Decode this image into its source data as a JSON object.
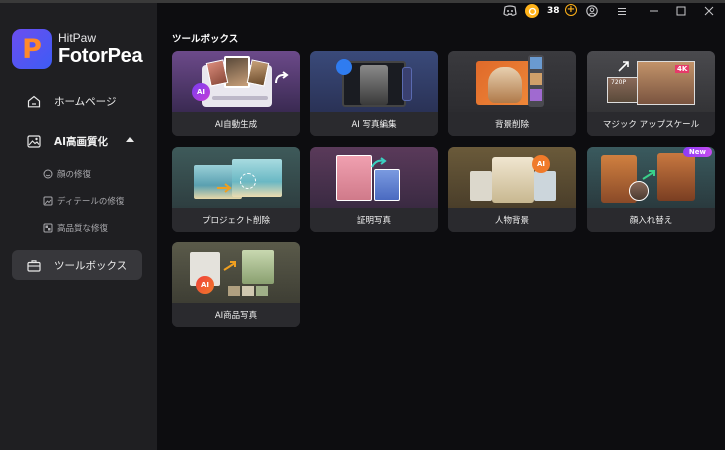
{
  "app": {
    "brand_small": "HitPaw",
    "brand_big": "FotorPea"
  },
  "titlebar": {
    "credits": "38",
    "plus": "+"
  },
  "sidebar": {
    "items": [
      {
        "label": "ホームページ"
      },
      {
        "label": "AI高画質化"
      },
      {
        "label": "ツールボックス"
      }
    ],
    "sub_items": [
      {
        "label": "顔の修復"
      },
      {
        "label": "ディテールの修復"
      },
      {
        "label": "高品質な修復"
      }
    ]
  },
  "main": {
    "section_title": "ツールボックス",
    "cards": [
      {
        "label": "AI自動生成"
      },
      {
        "label": "AI 写真編集"
      },
      {
        "label": "背景削除"
      },
      {
        "label": "マジック アップスケール"
      },
      {
        "label": "プロジェクト削除"
      },
      {
        "label": "証明写真"
      },
      {
        "label": "人物背景"
      },
      {
        "label": "顔入れ替え",
        "badge": "New"
      },
      {
        "label": "AI商品写真"
      }
    ],
    "thumb_badges": {
      "ai": "AI",
      "p720": "720P",
      "k4": "4K"
    }
  },
  "colors": {
    "sidebar_bg": "#1f1f22",
    "main_bg": "#0d0d10",
    "accent": "#7b4ef0",
    "coin": "#ffb21a"
  }
}
